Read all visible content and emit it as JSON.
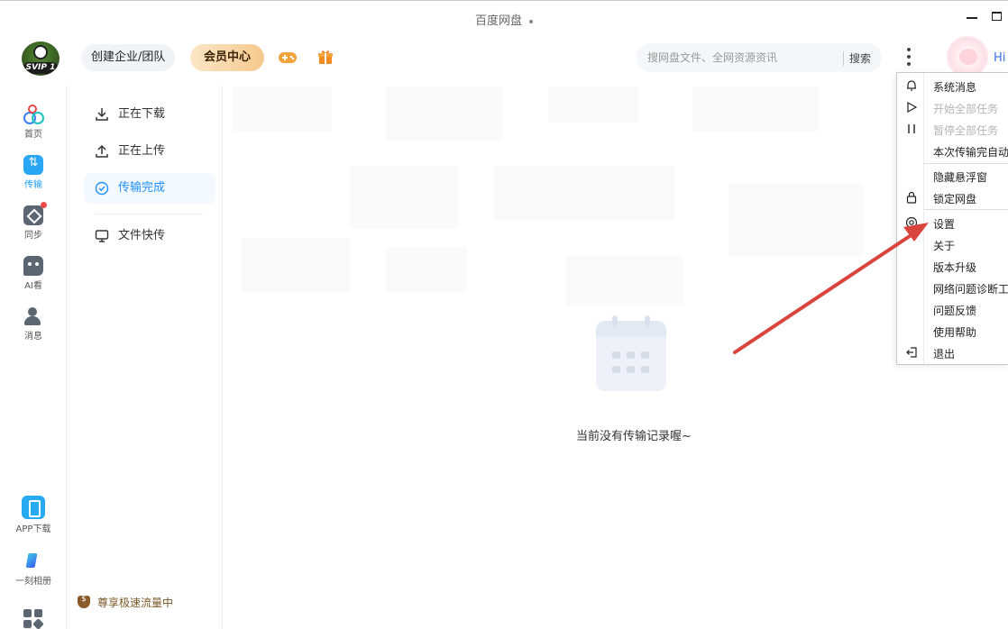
{
  "window": {
    "title": "百度网盘"
  },
  "header": {
    "logo_text": "SVIP 1",
    "team_button": "创建企业/团队",
    "vip_button": "会员中心",
    "search_placeholder": "搜网盘文件、全网资源资讯",
    "search_button": "搜索",
    "greeting": "Hi"
  },
  "leftnav": {
    "items": [
      {
        "label": "首页",
        "icon": "home-icon"
      },
      {
        "label": "传输",
        "icon": "transfer-icon"
      },
      {
        "label": "同步",
        "icon": "sync-icon"
      },
      {
        "label": "AI看",
        "icon": "ai-icon"
      },
      {
        "label": "消息",
        "icon": "message-icon"
      }
    ],
    "bottom": [
      {
        "label": "APP下载",
        "icon": "phone-icon"
      },
      {
        "label": "一刻相册",
        "icon": "album-icon"
      }
    ]
  },
  "subnav": {
    "items": [
      {
        "label": "正在下载",
        "icon": "download-icon"
      },
      {
        "label": "正在上传",
        "icon": "upload-icon"
      },
      {
        "label": "传输完成",
        "icon": "check-circle-icon"
      },
      {
        "label": "文件快传",
        "icon": "monitor-icon"
      }
    ],
    "speed_tip": "尊享极速流量中"
  },
  "main": {
    "empty_text": "当前没有传输记录喔~"
  },
  "menu": {
    "items": [
      {
        "label": "系统消息",
        "icon": "bell-icon",
        "disabled": false
      },
      {
        "label": "开始全部任务",
        "icon": "play-icon",
        "disabled": true
      },
      {
        "label": "暂停全部任务",
        "icon": "pause-icon",
        "disabled": true
      },
      {
        "label": "本次传输完自动",
        "icon": "",
        "disabled": false
      },
      {
        "label": "隐藏悬浮窗",
        "icon": "",
        "disabled": false
      },
      {
        "label": "锁定网盘",
        "icon": "lock-icon",
        "disabled": false
      },
      {
        "label": "设置",
        "icon": "settings-icon",
        "disabled": false
      },
      {
        "label": "关于",
        "icon": "",
        "disabled": false
      },
      {
        "label": "版本升级",
        "icon": "",
        "disabled": false
      },
      {
        "label": "网络问题诊断工",
        "icon": "",
        "disabled": false
      },
      {
        "label": "问题反馈",
        "icon": "",
        "disabled": false
      },
      {
        "label": "使用帮助",
        "icon": "",
        "disabled": false
      },
      {
        "label": "退出",
        "icon": "exit-icon",
        "disabled": false
      }
    ]
  },
  "colors": {
    "accent": "#1e90ff",
    "vip_gradient_start": "#fbe6c6",
    "vip_gradient_end": "#f6c98d",
    "annotation_arrow": "#d9443d"
  }
}
